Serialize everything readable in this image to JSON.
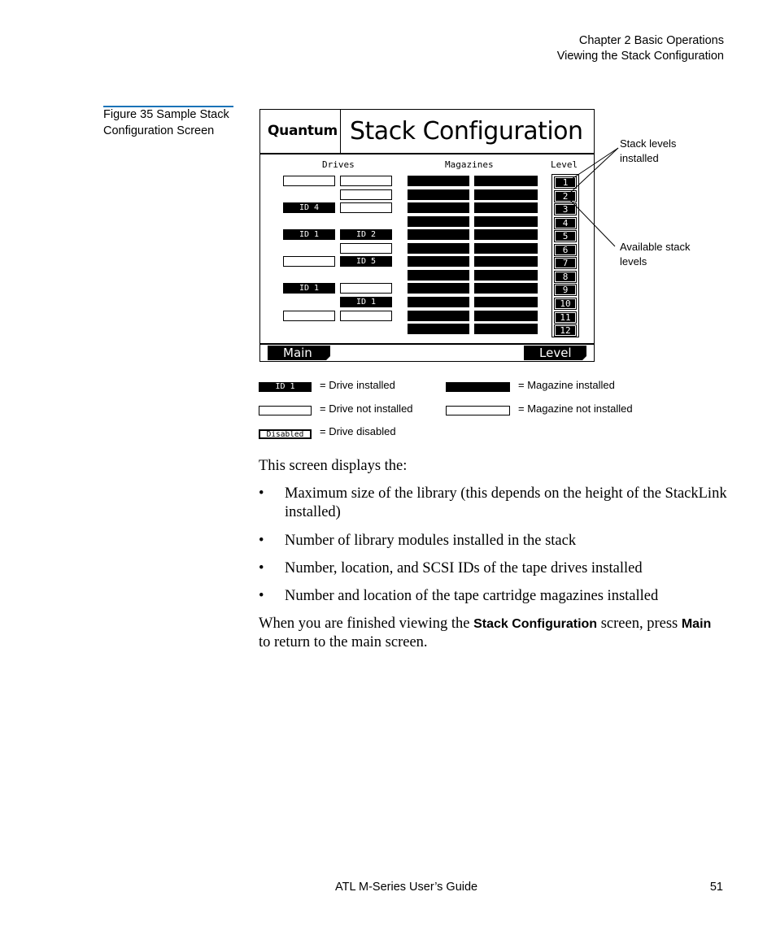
{
  "header": {
    "chapter": "Chapter 2  Basic Operations",
    "section": "Viewing the Stack Configuration"
  },
  "figure": {
    "caption": "Figure 35  Sample Stack Configuration Screen",
    "screen": {
      "brand": "Quantum",
      "title": "Stack Configuration",
      "columns": {
        "drives": "Drives",
        "magazines": "Magazines",
        "level": "Level"
      },
      "rows": [
        {
          "level": "1",
          "drive1": {
            "state": "empty"
          },
          "drive2": {
            "state": "empty"
          },
          "mag1": "installed",
          "mag2": "installed"
        },
        {
          "level": "2",
          "drive1": {
            "state": "none"
          },
          "drive2": {
            "state": "empty"
          },
          "mag1": "installed",
          "mag2": "installed"
        },
        {
          "level": "3",
          "drive1": {
            "state": "installed",
            "id": "ID 4"
          },
          "drive2": {
            "state": "empty"
          },
          "mag1": "installed",
          "mag2": "installed"
        },
        {
          "level": "4",
          "drive1": {
            "state": "none"
          },
          "drive2": {
            "state": "none"
          },
          "mag1": "installed",
          "mag2": "installed"
        },
        {
          "level": "5",
          "drive1": {
            "state": "installed",
            "id": "ID 1"
          },
          "drive2": {
            "state": "installed",
            "id": "ID 2"
          },
          "mag1": "installed",
          "mag2": "installed"
        },
        {
          "level": "6",
          "drive1": {
            "state": "none"
          },
          "drive2": {
            "state": "empty"
          },
          "mag1": "installed",
          "mag2": "installed"
        },
        {
          "level": "7",
          "drive1": {
            "state": "empty"
          },
          "drive2": {
            "state": "installed",
            "id": "ID 5"
          },
          "mag1": "installed",
          "mag2": "installed"
        },
        {
          "level": "8",
          "drive1": {
            "state": "none"
          },
          "drive2": {
            "state": "none"
          },
          "mag1": "installed",
          "mag2": "installed"
        },
        {
          "level": "9",
          "drive1": {
            "state": "installed",
            "id": "ID 1"
          },
          "drive2": {
            "state": "empty"
          },
          "mag1": "installed",
          "mag2": "installed"
        },
        {
          "level": "10",
          "drive1": {
            "state": "none"
          },
          "drive2": {
            "state": "installed",
            "id": "ID 1"
          },
          "mag1": "installed",
          "mag2": "installed"
        },
        {
          "level": "11",
          "drive1": {
            "state": "empty"
          },
          "drive2": {
            "state": "empty"
          },
          "mag1": "installed",
          "mag2": "installed"
        },
        {
          "level": "12",
          "drive1": {
            "state": "none"
          },
          "drive2": {
            "state": "none"
          },
          "mag1": "installed",
          "mag2": "installed"
        }
      ],
      "softkeys": {
        "left": "Main",
        "right": "Level"
      }
    },
    "callouts": {
      "installed": "Stack levels installed",
      "available": "Available stack levels"
    },
    "legend": {
      "drive_installed": {
        "swatch": "ID 1",
        "label": "= Drive installed"
      },
      "drive_not_installed": {
        "label": "= Drive not installed"
      },
      "drive_disabled": {
        "swatch": "Disabled",
        "label": "= Drive disabled"
      },
      "magazine_installed": {
        "label": "= Magazine installed"
      },
      "magazine_not_installed": {
        "label": "= Magazine not installed"
      }
    }
  },
  "body": {
    "intro": "This screen displays the:",
    "bullets": [
      "Maximum size of the library (this depends on the height of the StackLink installed)",
      "Number of library modules installed in the stack",
      "Number, location, and SCSI IDs of the tape drives installed",
      "Number and location of the tape cartridge magazines installed"
    ],
    "bullet_char": "•",
    "closing": {
      "part1": "When you are finished viewing the ",
      "bold1": "Stack Configuration",
      "part2": " screen, press ",
      "bold2": "Main",
      "part3": " to return to the main screen."
    }
  },
  "footer": {
    "guide_title": "ATL M-Series User’s Guide",
    "page_number": "51"
  }
}
